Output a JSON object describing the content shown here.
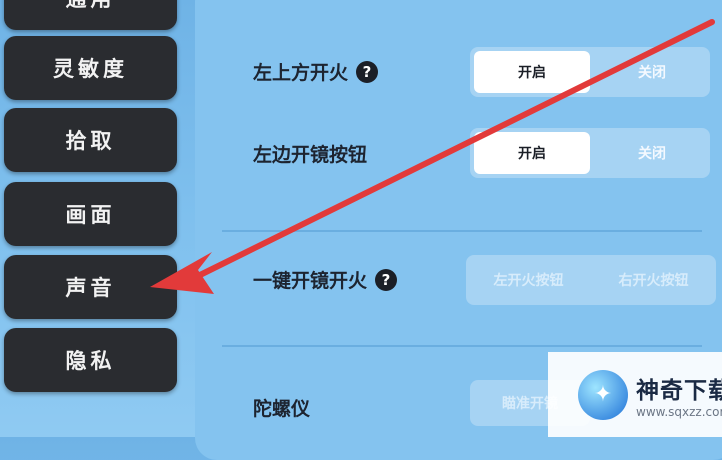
{
  "sidebar": {
    "items": [
      {
        "label": "通用"
      },
      {
        "label": "灵敏度"
      },
      {
        "label": "拾取"
      },
      {
        "label": "画面"
      },
      {
        "label": "声音"
      },
      {
        "label": "隐私"
      }
    ]
  },
  "settings": {
    "upper_left_fire": {
      "label": "左上方开火",
      "on": "开启",
      "off": "关闭"
    },
    "left_scope_button": {
      "label": "左边开镜按钮",
      "on": "开启",
      "off": "关闭"
    },
    "one_key_scope_fire": {
      "label": "一键开镜开火",
      "opt1": "左开火按钮",
      "opt2": "右开火按钮"
    },
    "gyroscope": {
      "label": "陀螺仪",
      "opt1": "瞄准开镜"
    }
  },
  "watermark": {
    "title": "神奇下载",
    "url": "www.sqxzz.com"
  },
  "colors": {
    "accent_arrow": "#e23a3a",
    "sidebar_bg": "#2a2c30",
    "panel_bg": "#84c3ef"
  }
}
